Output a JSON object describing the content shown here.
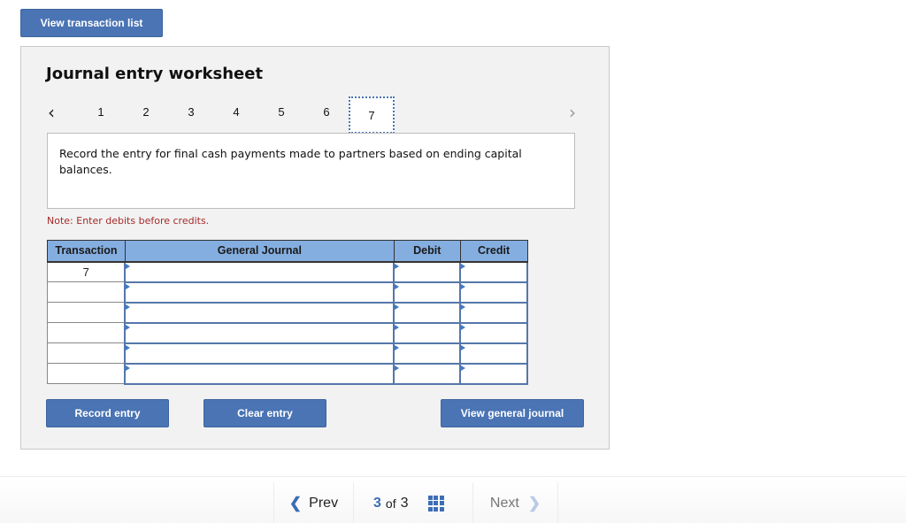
{
  "top": {
    "view_transaction_list_label": "View transaction list"
  },
  "worksheet": {
    "title": "Journal entry worksheet",
    "pager": {
      "prev_icon": "chevron-left-icon",
      "next_icon": "chevron-right-icon",
      "pages": [
        "1",
        "2",
        "3",
        "4",
        "5",
        "6",
        "7"
      ],
      "active_page": "7"
    },
    "prompt": "Record the entry for final cash payments made to partners based on ending capital balances.",
    "note": "Note: Enter debits before credits.",
    "table": {
      "headers": [
        "Transaction",
        "General Journal",
        "Debit",
        "Credit"
      ],
      "rows": [
        {
          "transaction": "7",
          "account": "",
          "debit": "",
          "credit": ""
        },
        {
          "transaction": "",
          "account": "",
          "debit": "",
          "credit": ""
        },
        {
          "transaction": "",
          "account": "",
          "debit": "",
          "credit": ""
        },
        {
          "transaction": "",
          "account": "",
          "debit": "",
          "credit": ""
        },
        {
          "transaction": "",
          "account": "",
          "debit": "",
          "credit": ""
        },
        {
          "transaction": "",
          "account": "",
          "debit": "",
          "credit": ""
        }
      ]
    },
    "buttons": {
      "record": "Record entry",
      "clear": "Clear entry",
      "view_general_journal": "View general journal"
    }
  },
  "footer": {
    "prev_label": "Prev",
    "current": "3",
    "of_label": "of",
    "total": "3",
    "next_label": "Next",
    "grid_icon": "grid-icon"
  },
  "colors": {
    "primary_button": "#4a74b4",
    "table_header": "#85aee0",
    "note_text": "#a52a2a",
    "accent": "#3d6db5"
  }
}
